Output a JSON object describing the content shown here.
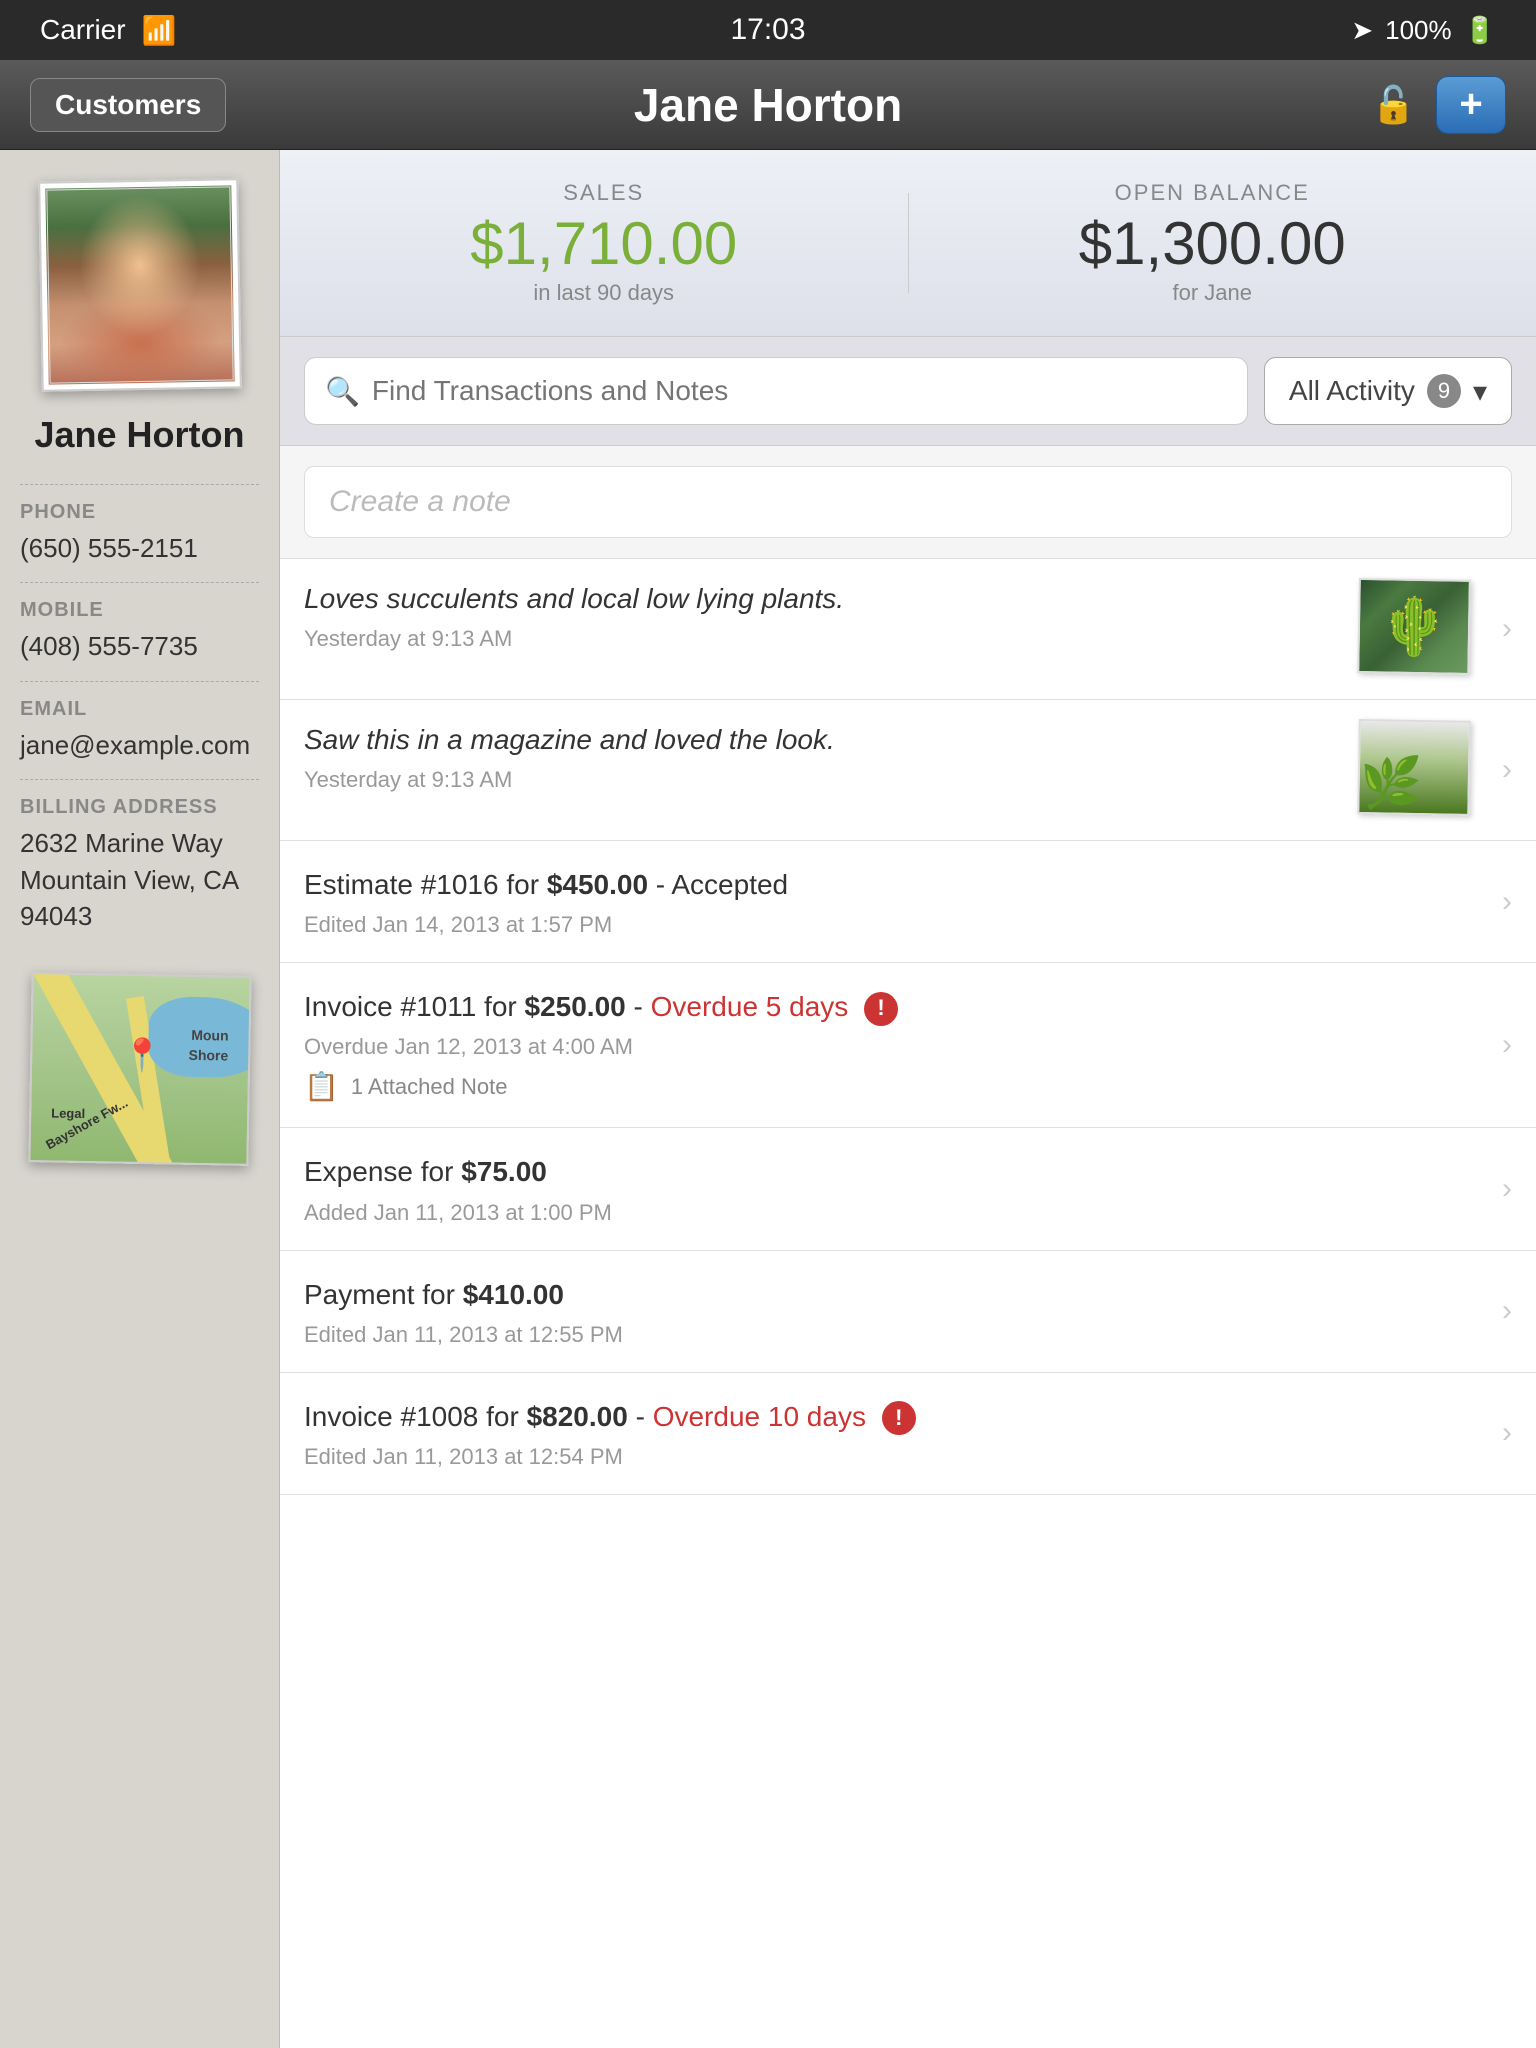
{
  "statusBar": {
    "carrier": "Carrier",
    "time": "17:03",
    "battery": "100%",
    "wifi": true
  },
  "navBar": {
    "backLabel": "Customers",
    "title": "Jane Horton",
    "addLabel": "+"
  },
  "sidebar": {
    "customerName": "Jane Horton",
    "phone": {
      "label": "PHONE",
      "value": "(650) 555-2151"
    },
    "mobile": {
      "label": "MOBILE",
      "value": "(408) 555-7735"
    },
    "email": {
      "label": "EMAIL",
      "value": "jane@example.com"
    },
    "billingAddress": {
      "label": "BILLING ADDRESS",
      "line1": "2632 Marine Way",
      "line2": "Mountain View, CA 94043"
    },
    "mapLabels": {
      "bayshore": "Bayshore Fw...",
      "moun": "Moun",
      "shore": "Shore",
      "legal": "Legal"
    }
  },
  "stats": {
    "salesLabel": "SALES",
    "salesValue": "$1,710.00",
    "salesSub": "in last 90 days",
    "balanceLabel": "OPEN BALANCE",
    "balanceValue": "$1,300.00",
    "balanceSub": "for Jane"
  },
  "searchBar": {
    "placeholder": "Find Transactions and Notes",
    "filterLabel": "All Activity",
    "filterCount": "9"
  },
  "noteCreate": {
    "placeholder": "Create a note"
  },
  "activityItems": [
    {
      "id": "note1",
      "type": "note",
      "title": "Loves succulents and local low lying plants.",
      "subtitle": "Yesterday at 9:13 AM",
      "hasImage": true,
      "imageType": "succulent"
    },
    {
      "id": "note2",
      "type": "note",
      "title": "Saw this in a magazine and loved the look.",
      "subtitle": "Yesterday at 9:13 AM",
      "hasImage": true,
      "imageType": "garden"
    },
    {
      "id": "estimate1",
      "type": "estimate",
      "titleStart": "Estimate #1016 for ",
      "titleBold": "$450.00",
      "titleEnd": " - Accepted",
      "subtitle": "Edited Jan 14, 2013 at 1:57 PM",
      "hasImage": false,
      "overdue": false
    },
    {
      "id": "invoice1",
      "type": "invoice",
      "titleStart": "Invoice #1011 for ",
      "titleBold": "$250.00",
      "titleEnd": " - ",
      "overdueText": "Overdue 5 days",
      "subtitle": "Overdue Jan 12, 2013 at 4:00 AM",
      "attachedNote": "1 Attached Note",
      "hasImage": false,
      "overdue": true
    },
    {
      "id": "expense1",
      "type": "expense",
      "titleStart": "Expense for ",
      "titleBold": "$75.00",
      "titleEnd": "",
      "subtitle": "Added Jan 11, 2013 at 1:00 PM",
      "hasImage": false,
      "overdue": false
    },
    {
      "id": "payment1",
      "type": "payment",
      "titleStart": "Payment for ",
      "titleBold": "$410.00",
      "titleEnd": "",
      "subtitle": "Edited Jan 11, 2013 at 12:55 PM",
      "hasImage": false,
      "overdue": false
    },
    {
      "id": "invoice2",
      "type": "invoice",
      "titleStart": "Invoice #1008 for ",
      "titleBold": "$820.00",
      "titleEnd": " - ",
      "overdueText": "Overdue 10 days",
      "subtitle": "Edited Jan 11, 2013 at 12:54 PM",
      "hasImage": false,
      "overdue": true
    }
  ]
}
